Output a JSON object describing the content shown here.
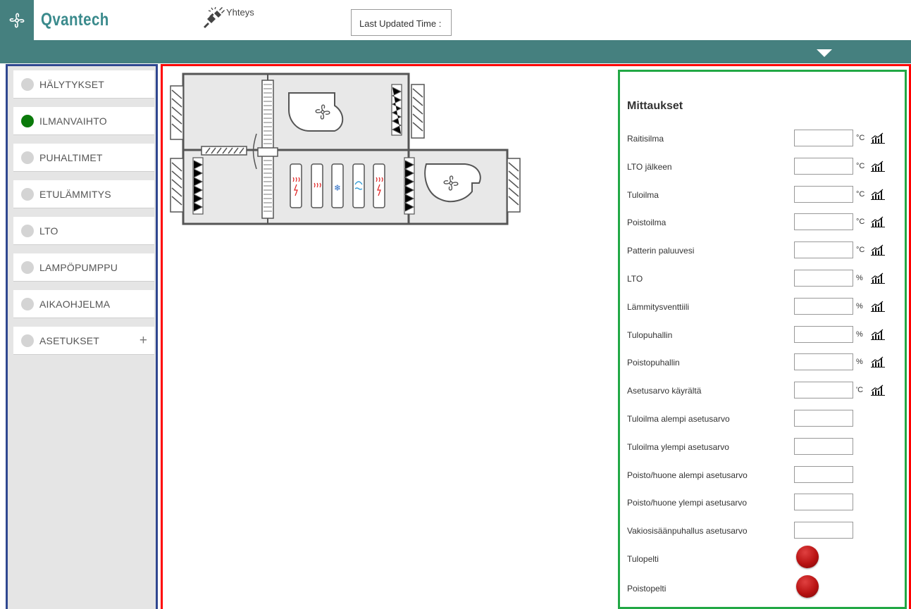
{
  "header": {
    "brand": "Qvantech",
    "connection_label": "Yhteys",
    "last_updated_label": "Last Updated Time :"
  },
  "sidebar": {
    "items": [
      {
        "label": "HÄLYTYKSET",
        "active": false
      },
      {
        "label": "ILMANVAIHTO",
        "active": true
      },
      {
        "label": "PUHALTIMET",
        "active": false
      },
      {
        "label": "ETULÄMMITYS",
        "active": false
      },
      {
        "label": "LTO",
        "active": false
      },
      {
        "label": "LAMPÖPUMPPU",
        "active": false
      },
      {
        "label": "AIKAOHJELMA",
        "active": false
      },
      {
        "label": "ASETUKSET",
        "active": false,
        "expand": "+"
      }
    ]
  },
  "measurements": {
    "title": "Mittaukset",
    "rows": [
      {
        "label": "Raitisilma",
        "value": "",
        "unit": "°C",
        "trend": true
      },
      {
        "label": "LTO jälkeen",
        "value": "",
        "unit": "°C",
        "trend": true
      },
      {
        "label": "Tuloilma",
        "value": "",
        "unit": "°C",
        "trend": true
      },
      {
        "label": "Poistoilma",
        "value": "",
        "unit": "°C",
        "trend": true
      },
      {
        "label": "Patterin paluuvesi",
        "value": "",
        "unit": "°C",
        "trend": true
      },
      {
        "label": "LTO",
        "value": "",
        "unit": "%",
        "trend": true
      },
      {
        "label": "Lämmitysventtiili",
        "value": "",
        "unit": "%",
        "trend": true
      },
      {
        "label": "Tulopuhallin",
        "value": "",
        "unit": "%",
        "trend": true
      },
      {
        "label": "Poistopuhallin",
        "value": "",
        "unit": "%",
        "trend": true
      },
      {
        "label": "Asetusarvo käyrältä",
        "value": "",
        "unit": "'C",
        "trend": true
      },
      {
        "label": "Tuloilma alempi asetusarvo",
        "value": "",
        "unit": "",
        "trend": false
      },
      {
        "label": "Tuloilma ylempi asetusarvo",
        "value": "",
        "unit": "",
        "trend": false
      },
      {
        "label": "Poisto/huone alempi asetusarvo",
        "value": "",
        "unit": "",
        "trend": false
      },
      {
        "label": "Poisto/huone ylempi asetusarvo",
        "value": "",
        "unit": "",
        "trend": false
      },
      {
        "label": "Vakiosisäänpuhallus asetusarvo",
        "value": "",
        "unit": "",
        "trend": false
      }
    ],
    "dampers": [
      {
        "label": "Tulopelti",
        "state_color": "#b81212"
      },
      {
        "label": "Poistopelti",
        "state_color": "#b81212"
      }
    ]
  },
  "colors": {
    "header_teal": "#45807f",
    "brand_teal": "#3a8a8c",
    "sidebar_border": "#2f4790",
    "main_border": "#ff0000",
    "measurements_border": "#22a845",
    "active_indicator": "#0b7a0b",
    "damper_red": "#b81212"
  },
  "icons": {
    "logo": "fan-icon",
    "connection": "plug-disconnected-icon",
    "menu": "dropdown-arrow-icon",
    "trend": "trend-chart-icon"
  }
}
